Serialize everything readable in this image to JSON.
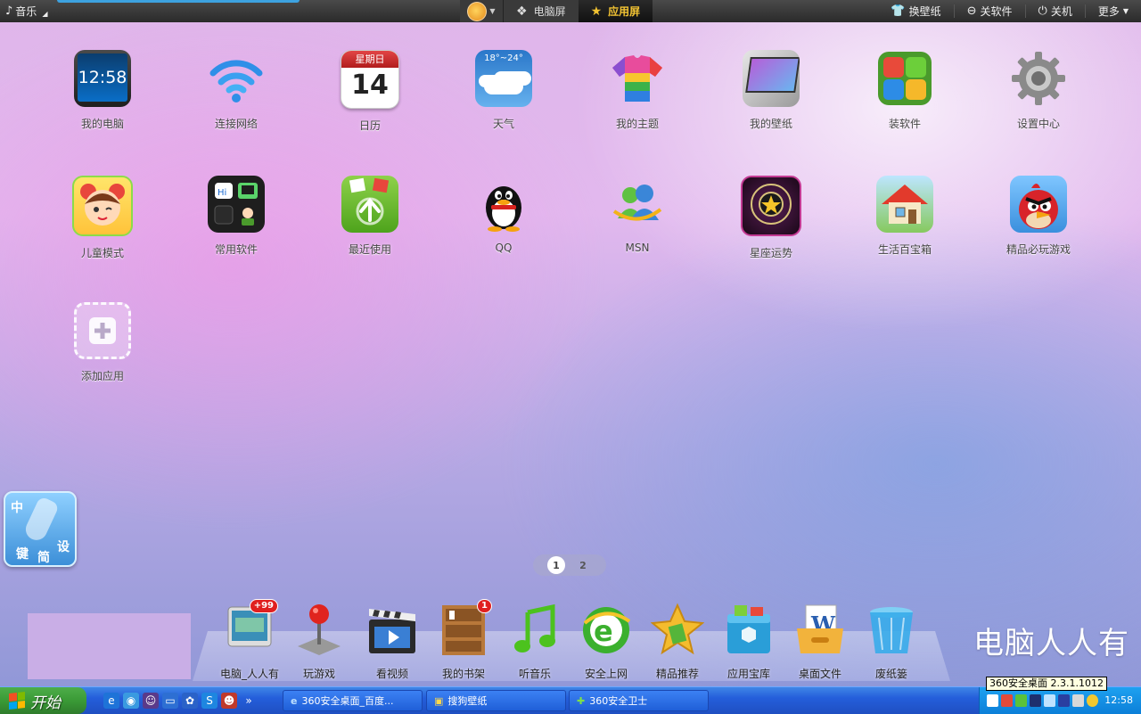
{
  "topbar": {
    "music_label": "音乐",
    "tab_pc": "电脑屏",
    "tab_app": "应用屏",
    "menu": [
      "换壁纸",
      "关软件",
      "关机",
      "更多"
    ]
  },
  "apps": [
    {
      "label": "我的电脑"
    },
    {
      "label": "连接网络"
    },
    {
      "label": "日历",
      "weekday": "星期日",
      "day": "14"
    },
    {
      "label": "天气",
      "temp": "18°~24°"
    },
    {
      "label": "我的主题"
    },
    {
      "label": "我的壁纸"
    },
    {
      "label": "装软件"
    },
    {
      "label": "设置中心"
    },
    {
      "label": "儿童模式"
    },
    {
      "label": "常用软件"
    },
    {
      "label": "最近使用"
    },
    {
      "label": "QQ"
    },
    {
      "label": "MSN"
    },
    {
      "label": "星座运势"
    },
    {
      "label": "生活百宝箱"
    },
    {
      "label": "精品必玩游戏"
    },
    {
      "label": "添加应用"
    }
  ],
  "pc_clock": "12:58",
  "bottle_widget": {
    "char1": "中",
    "char2": "键",
    "char3": "简",
    "char4": "设"
  },
  "pager": [
    "1",
    "2"
  ],
  "dock": [
    {
      "label": "电脑_人人有",
      "badge": "+99"
    },
    {
      "label": "玩游戏"
    },
    {
      "label": "看视频"
    },
    {
      "label": "我的书架",
      "badge": "1"
    },
    {
      "label": "听音乐"
    },
    {
      "label": "安全上网"
    },
    {
      "label": "精品推荐"
    },
    {
      "label": "应用宝库"
    },
    {
      "label": "桌面文件"
    },
    {
      "label": "废纸篓"
    }
  ],
  "brand_text": "电脑人人有",
  "taskbar": {
    "start_label": "开始",
    "buttons": [
      "360安全桌面_百度...",
      "搜狗壁纸",
      "360安全卫士"
    ],
    "tooltip": "360安全桌面 2.3.1.1012",
    "clock": "12:58"
  },
  "colors": {
    "accent_tab": "#f1c232",
    "taskbar": "#245edb",
    "start": "#3a9a36"
  }
}
